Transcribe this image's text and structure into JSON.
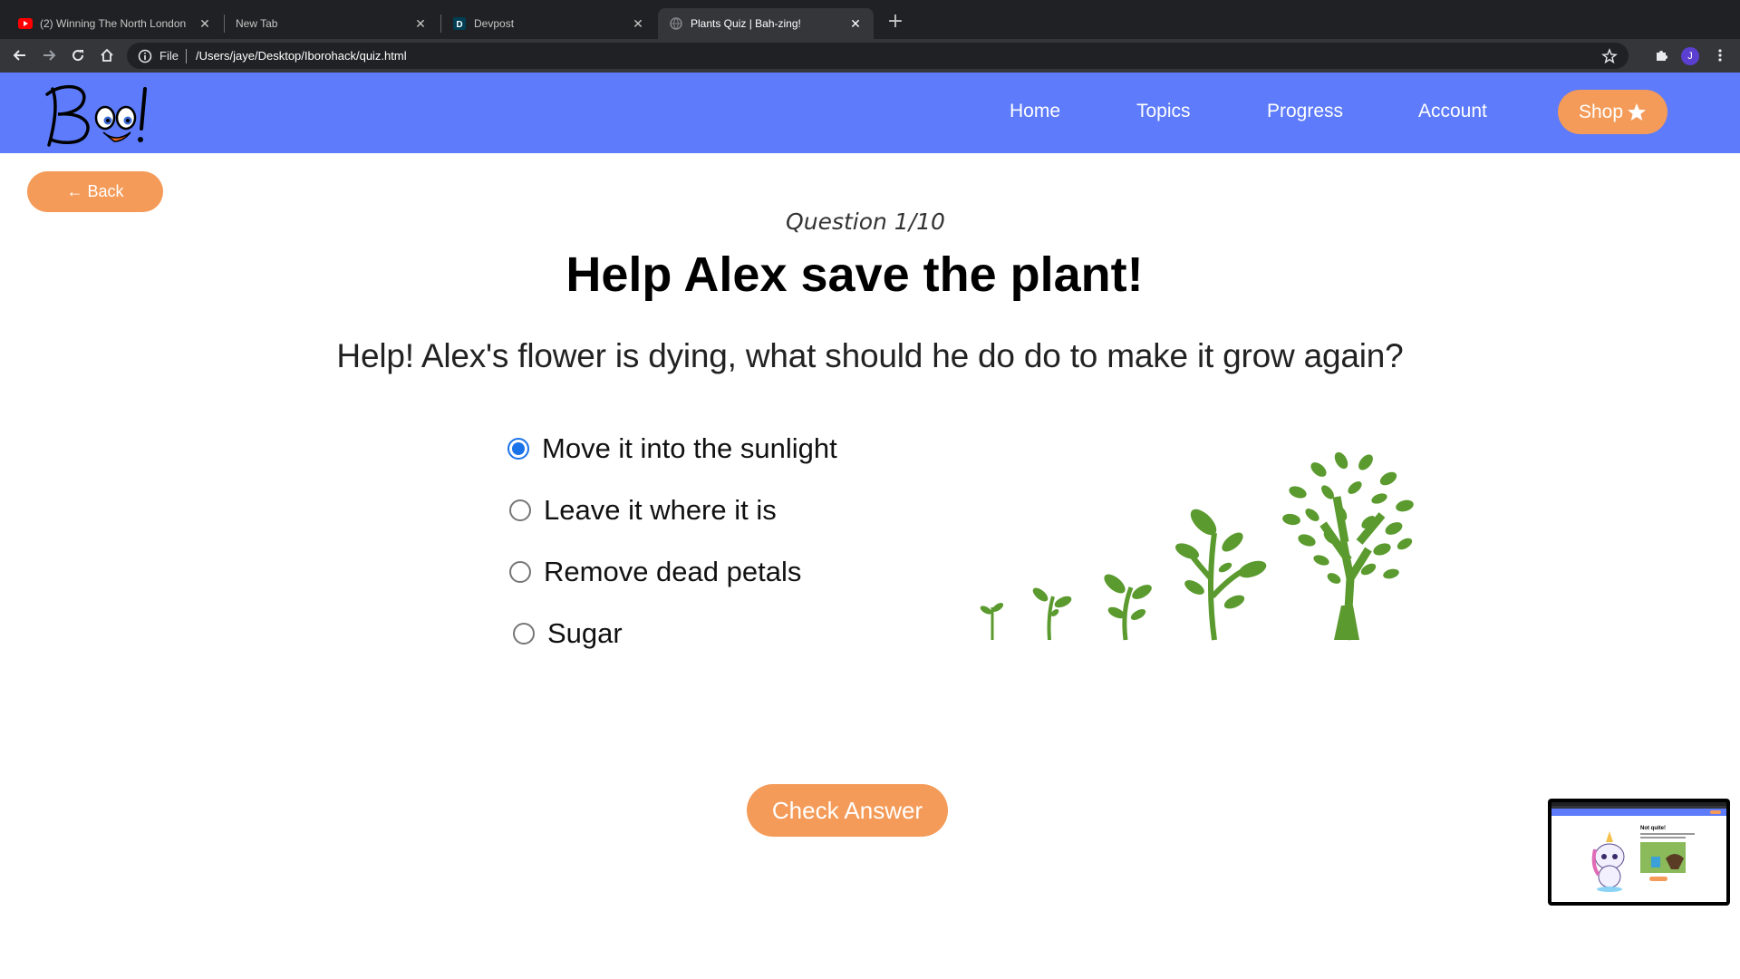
{
  "browser": {
    "tabs": [
      {
        "title": "(2) Winning The North London",
        "icon": "youtube-icon"
      },
      {
        "title": "New Tab",
        "icon": ""
      },
      {
        "title": "Devpost",
        "icon": "devpost-icon"
      },
      {
        "title": "Plants Quiz | Bah-zing!",
        "icon": "globe-icon",
        "active": true
      }
    ],
    "address": {
      "scheme": "File",
      "url": "/Users/jaye/Desktop/Iborohack/quiz.html"
    },
    "profile_initial": "J"
  },
  "site": {
    "logo_text": "Boo!",
    "nav": [
      "Home",
      "Topics",
      "Progress",
      "Account"
    ],
    "shop_label": "Shop",
    "accent_color": "#5d7bfa",
    "button_color": "#f49b59"
  },
  "quiz": {
    "back_label": "← Back",
    "question_number": "Question 1/10",
    "title": "Help Alex save the plant!",
    "question": "Help! Alex's flower is dying, what should he do do to make it grow again?",
    "options": [
      {
        "label": "Move it into the sunlight",
        "selected": true
      },
      {
        "label": "Leave it where it is",
        "selected": false
      },
      {
        "label": "Remove dead petals",
        "selected": false
      },
      {
        "label": "Sugar",
        "selected": false
      }
    ],
    "check_label": "Check Answer"
  },
  "pip_preview": {
    "heading": "Not quite!"
  }
}
